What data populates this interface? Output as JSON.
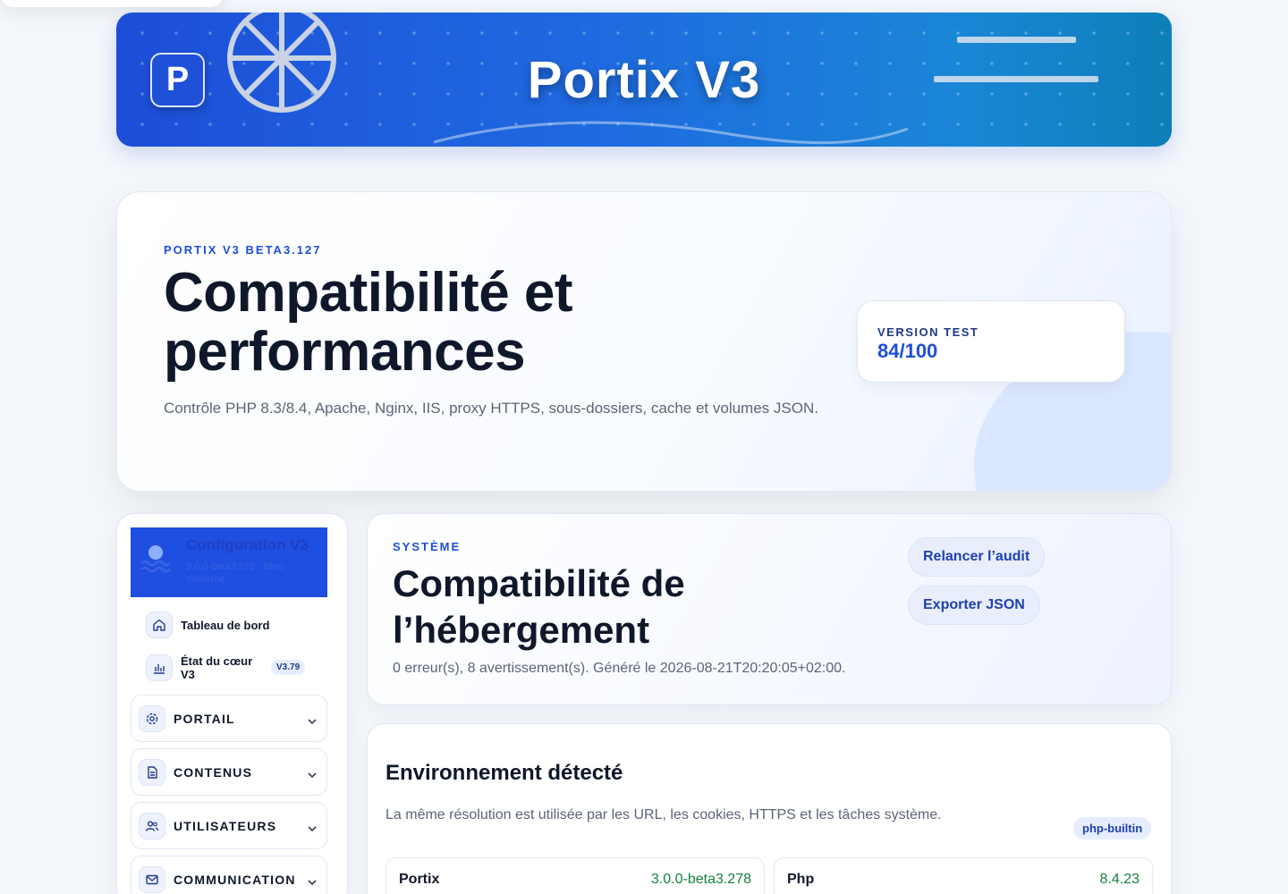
{
  "banner": {
    "logo_letter": "P",
    "title": "Portix V3"
  },
  "hero": {
    "kicker": "PORTIX V3 BETA3.127",
    "title_line1": "Compatibilité et",
    "title_line2": "performances",
    "description": "Contrôle PHP 8.3/8.4, Apache, Nginx, IIS, proxy HTTPS, sous-dossiers, cache et volumes JSON.",
    "badge_label": "VERSION TEST",
    "badge_value": "84/100"
  },
  "sidebar": {
    "header_title": "Configuration V3",
    "header_subtitle": "3.0.0-beta3.278 · Bleu moderne",
    "links": [
      {
        "label": "Tableau de bord",
        "icon": "home-icon"
      },
      {
        "label_line1": "État du cœur",
        "label_line2": "V3",
        "badge": "V3.79",
        "icon": "chart-icon"
      }
    ],
    "groups": [
      {
        "label": "PORTAIL",
        "icon": "gear-icon"
      },
      {
        "label": "CONTENUS",
        "icon": "document-icon"
      },
      {
        "label": "UTILISATEURS",
        "icon": "users-icon"
      },
      {
        "label": "COMMUNICATION",
        "icon": "mail-icon"
      }
    ]
  },
  "system": {
    "kicker": "SYSTÈME",
    "title_line1": "Compatibilité de",
    "title_line2": "l’hébergement",
    "summary": "0 erreur(s), 8 avertissement(s). Généré le 2026-08-21T20:20:05+02:00.",
    "buttons": {
      "rerun": "Relancer l’audit",
      "export": "Exporter JSON"
    }
  },
  "environment": {
    "title": "Environnement détecté",
    "description": "La même résolution est utilisée par les URL, les cookies, HTTPS et les tâches système.",
    "server_badge": "php-builtin",
    "items": [
      {
        "label": "Portix",
        "value": "3.0.0-beta3.278"
      },
      {
        "label": "Php",
        "value": "8.4.23"
      }
    ]
  },
  "colors": {
    "accent": "#1d4ed8",
    "ok_value": "#15803d",
    "text": "#0f172a",
    "muted": "#5b6577"
  }
}
